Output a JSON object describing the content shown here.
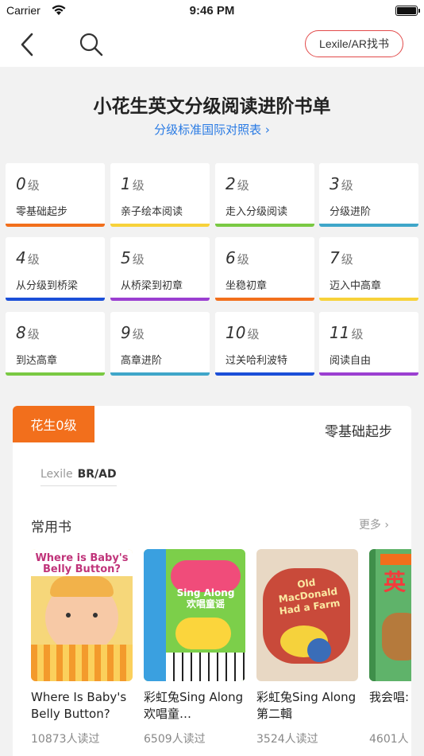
{
  "status": {
    "carrier": "Carrier",
    "time": "9:46 PM"
  },
  "nav": {
    "lexile_button": "Lexile/AR找书"
  },
  "header": {
    "title": "小花生英文分级阅读进阶书单",
    "subtitle": "分级标准国际对照表 ›"
  },
  "levels": [
    {
      "num": "0",
      "unit": "级",
      "name": "零基础起步",
      "color": "#f26f1c"
    },
    {
      "num": "1",
      "unit": "级",
      "name": "亲子绘本阅读",
      "color": "#f7d23a"
    },
    {
      "num": "2",
      "unit": "级",
      "name": "走入分级阅读",
      "color": "#7ac943"
    },
    {
      "num": "3",
      "unit": "级",
      "name": "分级进阶",
      "color": "#3fa6c9"
    },
    {
      "num": "4",
      "unit": "级",
      "name": "从分级到桥梁",
      "color": "#1b4fd8"
    },
    {
      "num": "5",
      "unit": "级",
      "name": "从桥梁到初章",
      "color": "#9b3fd1"
    },
    {
      "num": "6",
      "unit": "级",
      "name": "坐稳初章",
      "color": "#f26f1c"
    },
    {
      "num": "7",
      "unit": "级",
      "name": "迈入中高章",
      "color": "#f7d23a"
    },
    {
      "num": "8",
      "unit": "级",
      "name": "到达高章",
      "color": "#7ac943"
    },
    {
      "num": "9",
      "unit": "级",
      "name": "高章进阶",
      "color": "#3fa6c9"
    },
    {
      "num": "10",
      "unit": "级",
      "name": "过关哈利波特",
      "color": "#1b4fd8"
    },
    {
      "num": "11",
      "unit": "级",
      "name": "阅读自由",
      "color": "#9b3fd1"
    }
  ],
  "panel": {
    "tag": "花生0级",
    "tag_name": "零基础起步",
    "lexile_key": "Lexile",
    "lexile_value": "BR/AD",
    "section_title": "常用书",
    "more": "更多 ›",
    "books": [
      {
        "title": "Where Is Baby's Belly Button?",
        "reads": "10873人读过",
        "cover_text": "Where is Baby's Belly Button?"
      },
      {
        "title": "彩虹兔Sing Along 欢唱童…",
        "reads": "6509人读过",
        "cover_text": "Sing Along 欢唱童谣"
      },
      {
        "title": "彩虹兔Sing Along第二輯",
        "reads": "3524人读过",
        "cover_text": "Old MacDonald Had a Farm"
      },
      {
        "title": "我会唱:",
        "reads": "4601人",
        "cover_text": "英"
      }
    ]
  }
}
